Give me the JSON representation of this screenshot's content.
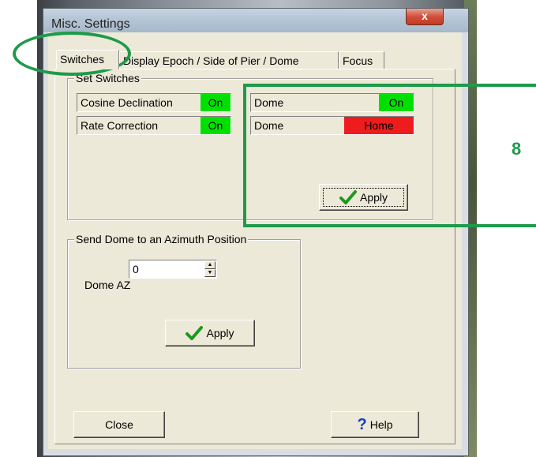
{
  "window": {
    "title": "Misc. Settings",
    "close_glyph": "x"
  },
  "tabs": [
    {
      "label": "Switches",
      "active": true
    },
    {
      "label": "Display Epoch / Side of Pier / Dome",
      "active": false
    },
    {
      "label": "Focus",
      "active": false
    }
  ],
  "set_switches": {
    "group_label": "Set Switches",
    "switches": [
      {
        "label": "Cosine Declination",
        "state": "On",
        "color": "#00e000"
      },
      {
        "label": "Rate Correction",
        "state": "On",
        "color": "#00e000"
      },
      {
        "label": "Dome",
        "state": "On",
        "color": "#00e000"
      },
      {
        "label": "Dome",
        "state": "Home",
        "color": "#ee1c1c"
      }
    ],
    "apply_label": "Apply"
  },
  "dome_azimuth": {
    "group_label": "Send Dome to an Azimuth Position",
    "field_label": "Dome AZ",
    "value": "0",
    "apply_label": "Apply"
  },
  "footer": {
    "close_label": "Close",
    "help_label": "Help"
  },
  "annotation": {
    "callout_number": "8",
    "color": "#1e9a4a"
  }
}
